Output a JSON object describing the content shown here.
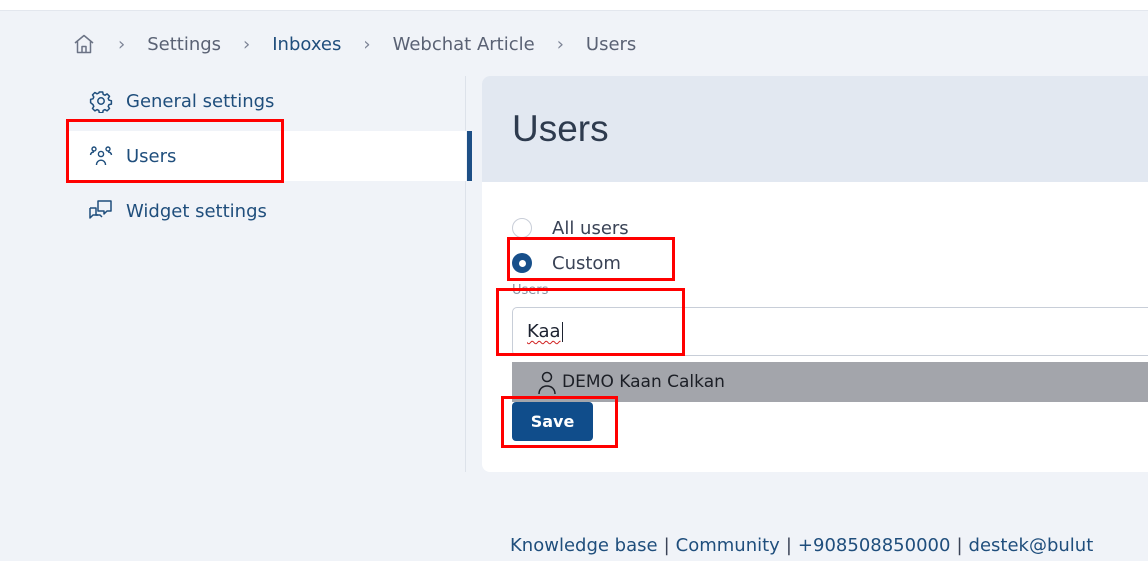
{
  "breadcrumb": {
    "items": [
      {
        "label": "Settings"
      },
      {
        "label": "Inboxes"
      },
      {
        "label": "Webchat Article"
      },
      {
        "label": "Users"
      }
    ]
  },
  "sidebar": {
    "items": [
      {
        "label": "General settings",
        "icon": "gear-icon"
      },
      {
        "label": "Users",
        "icon": "users-icon",
        "active": true
      },
      {
        "label": "Widget settings",
        "icon": "chat-bubbles-icon"
      }
    ]
  },
  "main": {
    "title": "Users",
    "radio_options": [
      {
        "label": "All users",
        "checked": false
      },
      {
        "label": "Custom",
        "checked": true
      }
    ],
    "users_field": {
      "label": "Users",
      "value": "Kaa"
    },
    "suggestion": {
      "label": "DEMO Kaan Calkan",
      "icon": "person-icon"
    },
    "save_label": "Save"
  },
  "footer": {
    "links": [
      "Knowledge base",
      "Community",
      "+908508850000",
      "destek@bulut"
    ]
  },
  "colors": {
    "accent": "#104d8b",
    "link": "#1f4e7c",
    "annotation": "#ff0000",
    "background": "#f0f3f8"
  }
}
